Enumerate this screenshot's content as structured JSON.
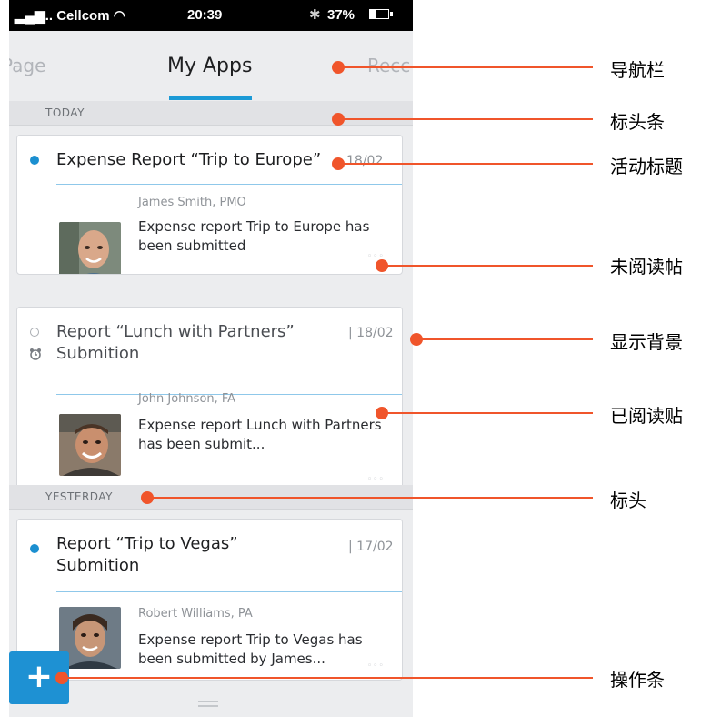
{
  "status_bar": {
    "signal": "▂▄▆.. Cellcom ◠",
    "time": "20:39",
    "bluetooth": "✱",
    "battery": "37%"
  },
  "nav": {
    "prev": "Page",
    "current": "My Apps",
    "next": "Recc"
  },
  "sections": {
    "today": "TODAY",
    "yesterday": "YESTERDAY"
  },
  "cards": [
    {
      "title": "Expense Report “Trip to Europe”",
      "date": "18/02",
      "author": "James Smith,  PMO",
      "excerpt": "Expense report Trip to Europe has been submitted",
      "more": "◦◦◦"
    },
    {
      "title_line1": "Report “Lunch with Partners”",
      "title_line2": "Submition",
      "date": "| 18/02",
      "author": "John Johnson,  FA",
      "excerpt": "Expense report Lunch with Partners has been submit...",
      "more": "◦◦◦"
    },
    {
      "title_line1": "Report “Trip to Vegas”",
      "title_line2": "Submition",
      "date": "| 17/02",
      "author": "Robert Williams,  PA",
      "excerpt": "Expense report Trip to Vegas has been submitted by James...",
      "more": "◦◦◦"
    }
  ],
  "fab": {
    "label": "+"
  },
  "annotations": [
    "导航栏",
    "标头条",
    "活动标题",
    "未阅读帖",
    "显示背景",
    "已阅读贴",
    "标头",
    "操作条"
  ],
  "colors": {
    "accent": "#1b9ad6",
    "annotation": "#f0552b"
  }
}
